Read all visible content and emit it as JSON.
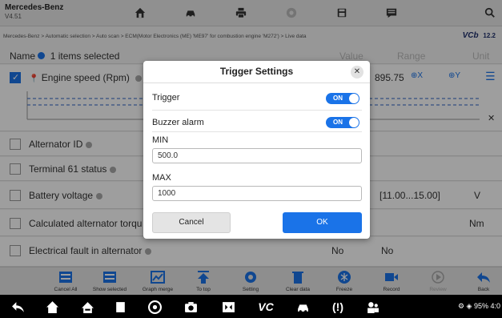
{
  "app": {
    "brand": "Mercedes-Benz",
    "version": "V4.51"
  },
  "breadcrumb": "Mercedes-Benz > Automatic selection > Auto scan > ECM(Motor Electronics (ME) 'ME97' for combustion engine 'M272') > Live data",
  "vci": {
    "logo": "VCb",
    "battery": "12.2"
  },
  "table": {
    "header": {
      "selected_count": "1 items selected",
      "name_prefix": "Name",
      "value": "Value",
      "range": "Range",
      "unit": "Unit"
    },
    "rows": [
      {
        "name": "Engine speed  (Rpm)",
        "checked": true,
        "value": "",
        "range": "895.75",
        "unit": ""
      },
      {
        "name": "Alternator ID",
        "checked": false,
        "value": "",
        "range": "",
        "unit": ""
      },
      {
        "name": "Terminal 61 status",
        "checked": false,
        "value": "",
        "range": "",
        "unit": ""
      },
      {
        "name": "Battery voltage",
        "checked": false,
        "value": "",
        "range": "[11.00...15.00]",
        "unit": "V"
      },
      {
        "name": "Calculated alternator torqu",
        "checked": false,
        "value": "",
        "range": "",
        "unit": "Nm"
      },
      {
        "name": "Electrical fault in alternator",
        "checked": false,
        "value": "No",
        "range": "No",
        "unit": ""
      }
    ]
  },
  "toolbar": [
    {
      "label": "Cancel All",
      "icon": "cancel-all-icon"
    },
    {
      "label": "Show selected",
      "icon": "show-selected-icon"
    },
    {
      "label": "Graph merge",
      "icon": "graph-merge-icon"
    },
    {
      "label": "To top",
      "icon": "to-top-icon"
    },
    {
      "label": "Setting",
      "icon": "setting-icon"
    },
    {
      "label": "Clear data",
      "icon": "clear-data-icon"
    },
    {
      "label": "Freeze",
      "icon": "freeze-icon"
    },
    {
      "label": "Record",
      "icon": "record-icon"
    },
    {
      "label": "Review",
      "icon": "review-icon"
    },
    {
      "label": "Back",
      "icon": "back-icon"
    }
  ],
  "dialog": {
    "title": "Trigger Settings",
    "trigger_label": "Trigger",
    "trigger_state": "ON",
    "buzzer_label": "Buzzer alarm",
    "buzzer_state": "ON",
    "min_label": "MIN",
    "min_value": "500.0",
    "max_label": "MAX",
    "max_value": "1000",
    "cancel_label": "Cancel",
    "ok_label": "OK"
  },
  "navbar": {
    "status_text": "95%",
    "battery_glyph": "4:0"
  },
  "colors": {
    "accent": "#1a73e8",
    "navbar": "#000000"
  }
}
